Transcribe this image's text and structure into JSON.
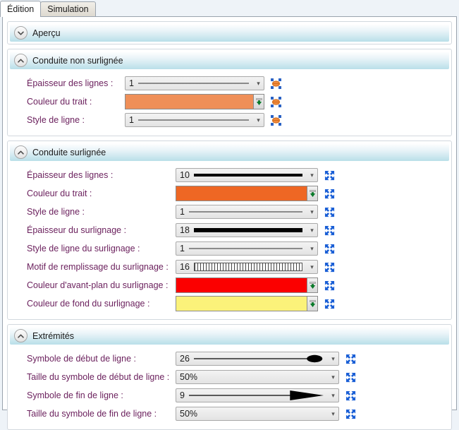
{
  "tabs": [
    {
      "label": "Édition",
      "active": true
    },
    {
      "label": "Simulation",
      "active": false
    }
  ],
  "sections": [
    {
      "id": "apercu",
      "title": "Aperçu",
      "collapsed": true,
      "toggle_icon": "chevron-down-icon",
      "rows": []
    },
    {
      "id": "conduite-non-surlignee",
      "title": "Conduite non surlignée",
      "collapsed": false,
      "toggle_icon": "chevron-up-icon",
      "rows": [
        {
          "label": "Épaisseur des lignes :",
          "type": "combo-line",
          "value": "1",
          "line_weight": 1,
          "expr_icon": "expression-override-icon"
        },
        {
          "label": "Couleur du trait :",
          "type": "color",
          "value": "#EF8F58",
          "expr_icon": "expression-override-icon"
        },
        {
          "label": "Style de ligne :",
          "type": "combo-line",
          "value": "1",
          "line_weight": 1,
          "expr_icon": "expression-override-icon"
        }
      ]
    },
    {
      "id": "conduite-surlignee",
      "title": "Conduite surlignée",
      "collapsed": false,
      "toggle_icon": "chevron-up-icon",
      "rows": [
        {
          "label": "Épaisseur des lignes :",
          "type": "combo-line",
          "value": "10",
          "line_weight": 4,
          "expr_icon": "expand-arrows-icon"
        },
        {
          "label": "Couleur du trait :",
          "type": "color",
          "value": "#EE6724",
          "expr_icon": "expand-arrows-icon"
        },
        {
          "label": "Style de ligne :",
          "type": "combo-line",
          "value": "1",
          "line_weight": 1,
          "expr_icon": "expand-arrows-icon"
        },
        {
          "label": "Épaisseur du surlignage :",
          "type": "combo-line",
          "value": "18",
          "line_weight": 6,
          "expr_icon": "expand-arrows-icon"
        },
        {
          "label": "Style de ligne du surlignage :",
          "type": "combo-line",
          "value": "1",
          "line_weight": 1,
          "expr_icon": "expand-arrows-icon"
        },
        {
          "label": "Motif de remplissage du surlignage :",
          "type": "combo-hatch",
          "value": "16",
          "expr_icon": "expand-arrows-icon"
        },
        {
          "label": "Couleur d'avant-plan du surlignage :",
          "type": "color",
          "value": "#FB0000",
          "expr_icon": "expand-arrows-icon"
        },
        {
          "label": "Couleur de fond du surlignage :",
          "type": "color",
          "value": "#FBF27A",
          "expr_icon": "expand-arrows-icon"
        }
      ]
    },
    {
      "id": "extremites",
      "title": "Extrémités",
      "collapsed": false,
      "toggle_icon": "chevron-up-icon",
      "rows": [
        {
          "label": "Symbole de début de ligne :",
          "type": "combo-dot",
          "value": "26",
          "expr_icon": "expand-arrows-icon"
        },
        {
          "label": "Taille du symbole de début de ligne :",
          "type": "combo-plain",
          "value": "50%",
          "expr_icon": "expand-arrows-icon"
        },
        {
          "label": "Symbole de fin de ligne :",
          "type": "combo-arrow",
          "value": "9",
          "expr_icon": "expand-arrows-icon"
        },
        {
          "label": "Taille du symbole de fin de ligne :",
          "type": "combo-plain",
          "value": "50%",
          "expr_icon": "expand-arrows-icon"
        }
      ]
    }
  ],
  "colors": {
    "label_text": "#6A1F5C",
    "header_gradient_top": "#FFFFFF",
    "header_gradient_bottom": "#B9DFE9",
    "panel_background": "#FFFFFF",
    "app_background": "#EEF3F8"
  }
}
